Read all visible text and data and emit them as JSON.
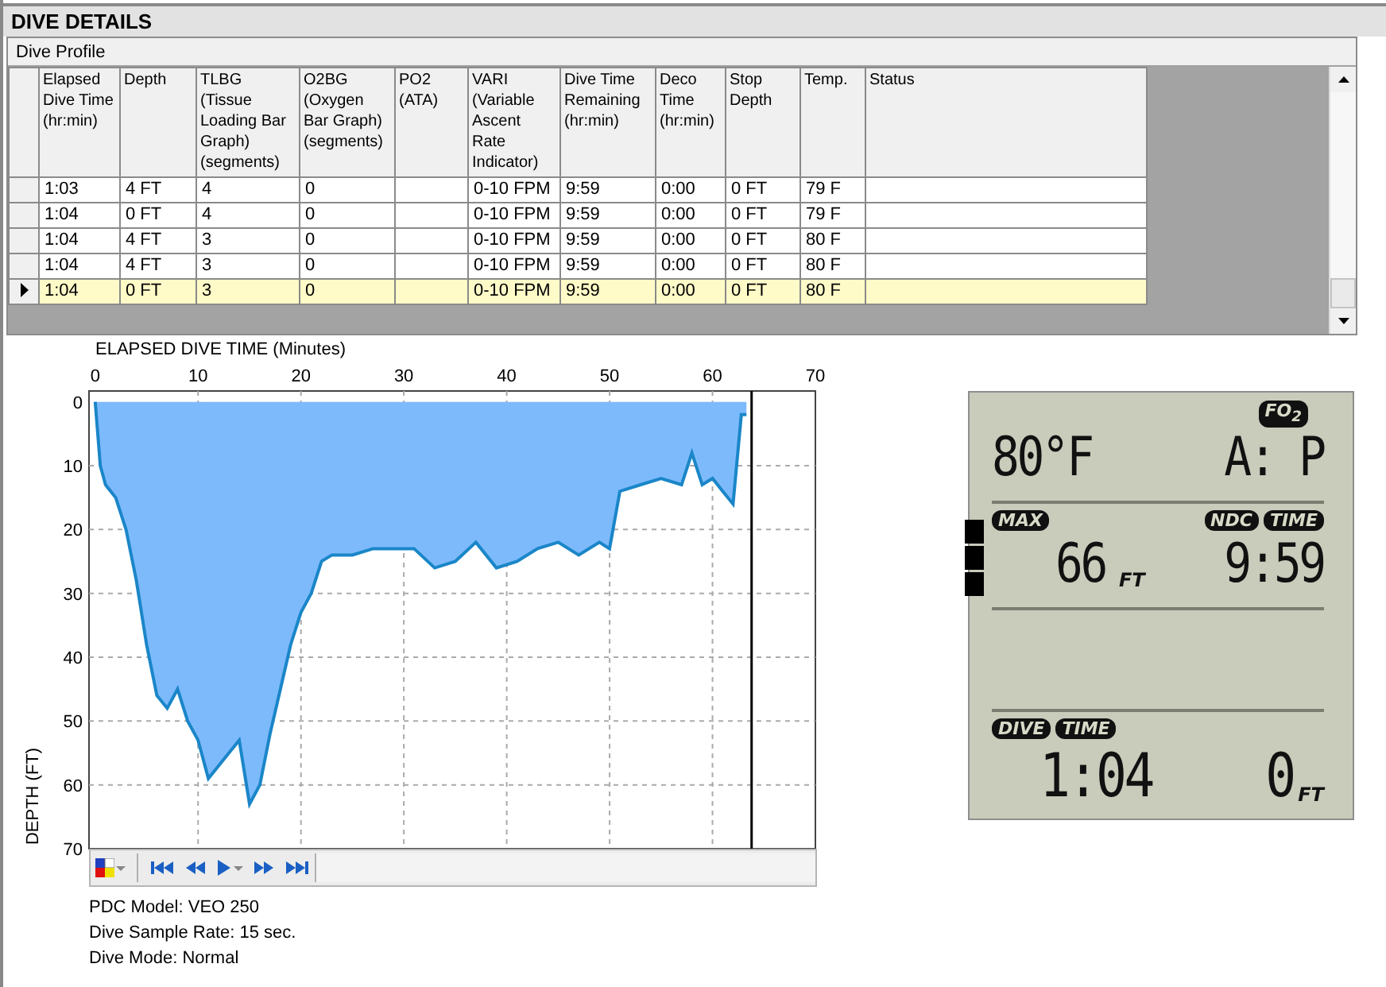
{
  "section_title": "DIVE DETAILS",
  "profile": {
    "title": "Dive Profile",
    "columns": [
      "Elapsed Dive Time (hr:min)",
      "Depth",
      "TLBG (Tissue Loading Bar Graph) (segments)",
      "O2BG (Oxygen Bar Graph) (segments)",
      "PO2 (ATA)",
      "VARI (Variable Ascent Rate Indicator)",
      "Dive Time Remaining (hr:min)",
      "Deco Time (hr:min)",
      "Stop Depth",
      "Temp.",
      "Status"
    ],
    "rows": [
      {
        "selected": false,
        "cells": [
          "1:03",
          "4 FT",
          "4",
          "0",
          null,
          "0-10 FPM",
          "9:59",
          "0:00",
          "0 FT",
          "79 F",
          null
        ]
      },
      {
        "selected": false,
        "cells": [
          "1:04",
          "0 FT",
          "4",
          "0",
          null,
          "0-10 FPM",
          "9:59",
          "0:00",
          "0 FT",
          "79 F",
          null
        ]
      },
      {
        "selected": false,
        "cells": [
          "1:04",
          "4 FT",
          "3",
          "0",
          null,
          "0-10 FPM",
          "9:59",
          "0:00",
          "0 FT",
          "80 F",
          null
        ]
      },
      {
        "selected": false,
        "cells": [
          "1:04",
          "4 FT",
          "3",
          "0",
          null,
          "0-10 FPM",
          "9:59",
          "0:00",
          "0 FT",
          "80 F",
          null
        ]
      },
      {
        "selected": true,
        "cells": [
          "1:04",
          "0 FT",
          "3",
          "0",
          null,
          "0-10 FPM",
          "9:59",
          "0:00",
          "0 FT",
          "80 F",
          null
        ]
      }
    ]
  },
  "chart": {
    "chart_data": {
      "type": "area",
      "xlabel": "ELAPSED DIVE TIME (Minutes)",
      "ylabel": "DEPTH (FT)",
      "x": [
        0,
        0.5,
        1,
        2,
        3,
        4,
        5,
        6,
        7,
        8,
        9,
        10,
        11,
        12,
        13,
        14,
        15,
        16,
        17,
        18,
        19,
        20,
        21,
        22,
        23,
        25,
        27,
        29,
        31,
        33,
        35,
        37,
        39,
        41,
        43,
        45,
        47,
        49,
        50,
        51,
        53,
        55,
        57,
        58,
        59,
        60,
        61,
        62,
        62.8,
        63.3
      ],
      "series": [
        {
          "color": "#1a86c8",
          "values": [
            0,
            10,
            13,
            15,
            20,
            28,
            38,
            46,
            48,
            45,
            50,
            53,
            59,
            57,
            55,
            53,
            63,
            60,
            52,
            45,
            38,
            33,
            30,
            25,
            24,
            24,
            23,
            23,
            23,
            26,
            25,
            22,
            26,
            25,
            23,
            22,
            24,
            22,
            23,
            14,
            13,
            12,
            13,
            8,
            13,
            12,
            14,
            16,
            2,
            2
          ]
        }
      ],
      "xlim": [
        -0.6,
        70
      ],
      "ylim": [
        70,
        -1.7
      ],
      "grid": true,
      "ref_lines": [
        {
          "axis": "x",
          "value": 63.8
        }
      ],
      "xticks": [
        0,
        10,
        20,
        30,
        40,
        50,
        60,
        70
      ],
      "yticks": [
        0,
        10,
        20,
        30,
        40,
        50,
        60,
        70
      ]
    }
  },
  "info": [
    "PDC Model: VEO 250",
    "Dive Sample Rate: 15 sec.",
    "Dive Mode: Normal"
  ],
  "display": {
    "fo2_label": "FO$_{2}$",
    "temperature": "80°F",
    "fo2_value": "A: P",
    "max_label": "MAX",
    "ndc_label": "NDC",
    "ndc_time_label": "TIME",
    "max_depth": "66",
    "max_unit": "FT",
    "ndc_time": "9:59",
    "dive_label": "DIVE",
    "dive_time_label": "TIME",
    "dive_time": "1:04",
    "depth": "0",
    "depth_unit": "FT"
  }
}
